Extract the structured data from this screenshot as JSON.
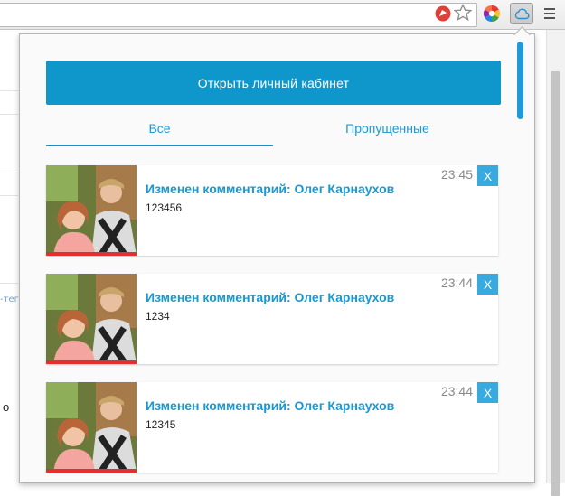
{
  "popup": {
    "open_cabinet_label": "Открыть личный кабинет",
    "tabs": [
      {
        "label": "Все",
        "active": true
      },
      {
        "label": "Пропущенные",
        "active": false
      }
    ],
    "notifications": [
      {
        "title": "Изменен комментарий: Олег Карнаухов",
        "text": "123456",
        "time": "23:45",
        "close_label": "X"
      },
      {
        "title": "Изменен комментарий: Олег Карнаухов",
        "text": "1234",
        "time": "23:44",
        "close_label": "X"
      },
      {
        "title": "Изменен комментарий: Олег Карнаухов",
        "text": "12345",
        "time": "23:44",
        "close_label": "X"
      }
    ]
  },
  "background_page": {
    "link_fragment": "-теги",
    "letter_fragment": "о"
  },
  "toolbar": {
    "icons": [
      "adblock-extension-icon",
      "bookmark-star-icon",
      "color-picker-extension-icon",
      "cloud-extension-icon",
      "chrome-menu-icon"
    ]
  },
  "colors": {
    "accent": "#0f97cc",
    "title": "#1899d0",
    "close_button": "#37abe0",
    "tab_text": "#1a9ad6"
  }
}
